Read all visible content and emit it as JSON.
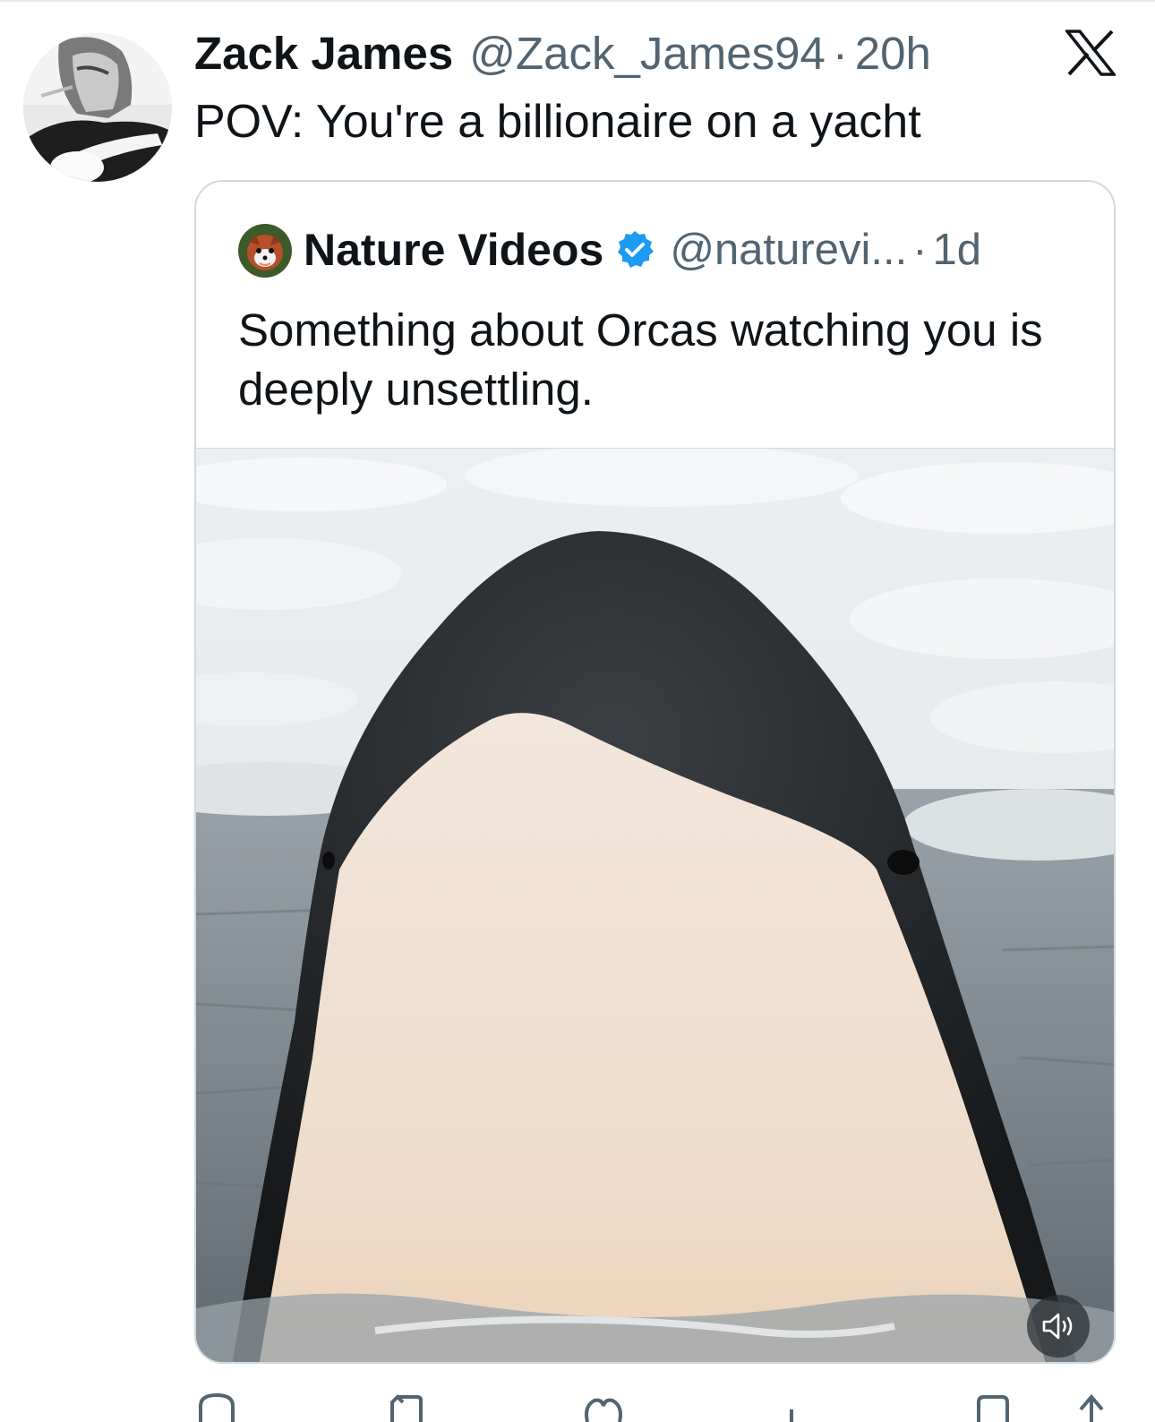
{
  "tweet": {
    "author_name": "Zack James",
    "handle": "@Zack_James94",
    "separator": "·",
    "time": "20h",
    "text": "POV: You're a billionaire on a yacht"
  },
  "quoted_tweet": {
    "author_name": "Nature Videos",
    "verified": true,
    "handle": "@naturevi...",
    "separator": "·",
    "time": "1d",
    "text": "Something about Orcas watching you is deeply unsettling.",
    "media": {
      "type": "video",
      "muted": true
    }
  },
  "icons": {
    "platform_logo": "x-logo-icon",
    "verified": "verified-badge-icon",
    "mute": "speaker-mute-icon",
    "actions": [
      "reply-icon",
      "retweet-icon",
      "like-icon",
      "views-icon",
      "bookmark-icon",
      "share-icon"
    ]
  },
  "colors": {
    "text_primary": "#0f1419",
    "text_secondary": "#536471",
    "verified_blue": "#1d9bf0",
    "card_border": "#cfd9de"
  }
}
